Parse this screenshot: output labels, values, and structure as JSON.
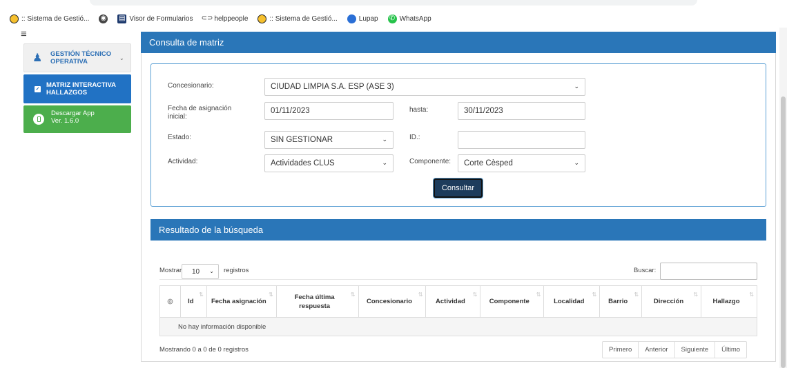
{
  "bookmarks": [
    {
      "label": ":: Sistema de Gestió...",
      "icon": "smiley-face-icon"
    },
    {
      "label": "",
      "icon": "globe-icon"
    },
    {
      "label": "Visor de Formularios",
      "icon": "form-viewer-icon"
    },
    {
      "label": "helppeople",
      "icon": "helppeople-icon"
    },
    {
      "label": ":: Sistema de Gestió...",
      "icon": "smiley-face-icon"
    },
    {
      "label": "Lupap",
      "icon": "lupap-icon"
    },
    {
      "label": "WhatsApp",
      "icon": "whatsapp-icon"
    }
  ],
  "sidebar": {
    "items": [
      {
        "label": "GESTIÓN TÉCNICO OPERATIVA",
        "icon": "user-icon"
      },
      {
        "label": "MATRIZ INTERACTIVA HALLAZGOS",
        "icon": "checkbox-icon"
      },
      {
        "label": "Descargar App Ver. 1.6.0",
        "icon": "mobile-device-icon"
      }
    ]
  },
  "main": {
    "title": "Consulta de matriz"
  },
  "form": {
    "concesionario_label": "Concesionario:",
    "concesionario_value": "CIUDAD LIMPIA S.A. ESP (ASE 3)",
    "fecha_label": "Fecha de asignación inicial:",
    "fecha_value": "01/11/2023",
    "hasta_label": "hasta:",
    "hasta_value": "30/11/2023",
    "estado_label": "Estado:",
    "estado_value": "SIN GESTIONAR",
    "id_label": "ID.:",
    "id_value": "",
    "actividad_label": "Actividad:",
    "actividad_value": "Actividades CLUS",
    "componente_label": "Componente:",
    "componente_value": "Corte Cèsped",
    "consultar_label": "Consultar"
  },
  "results": {
    "title": "Resultado de la búsqueda",
    "show_label": "Mostrar",
    "page_length": "10",
    "records_label": "registros",
    "search_label": "Buscar:",
    "columns": [
      "Id",
      "Fecha asignación",
      "Fecha última respuesta",
      "Concesionario",
      "Actividad",
      "Componente",
      "Localidad",
      "Barrio",
      "Dirección",
      "Hallazgo"
    ],
    "empty_message": "No hay información disponible",
    "info": "Mostrando 0 a 0 de 0 registros",
    "pager": [
      "Primero",
      "Anterior",
      "Siguiente",
      "Último"
    ]
  },
  "colors": {
    "header_blue": "#2a76b8",
    "active_item": "#2172c4",
    "app_green": "#4cae4c",
    "button_dark": "#1d3c5c"
  }
}
